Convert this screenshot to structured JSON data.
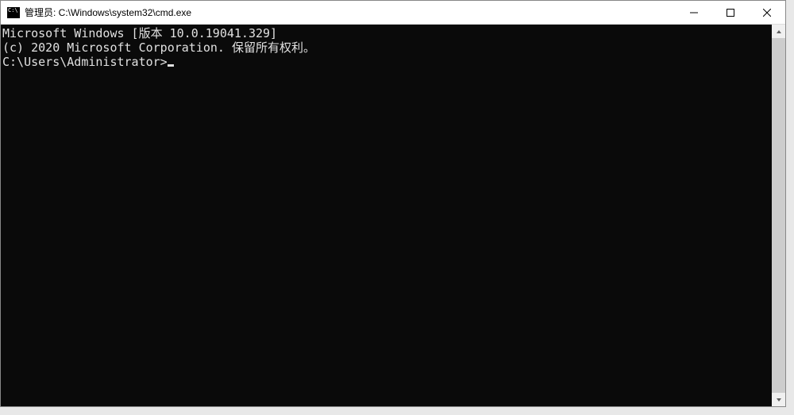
{
  "titlebar": {
    "title": "管理员: C:\\Windows\\system32\\cmd.exe"
  },
  "terminal": {
    "line1": "Microsoft Windows [版本 10.0.19041.329]",
    "line2": "(c) 2020 Microsoft Corporation. 保留所有权利。",
    "blank": "",
    "prompt": "C:\\Users\\Administrator>"
  }
}
